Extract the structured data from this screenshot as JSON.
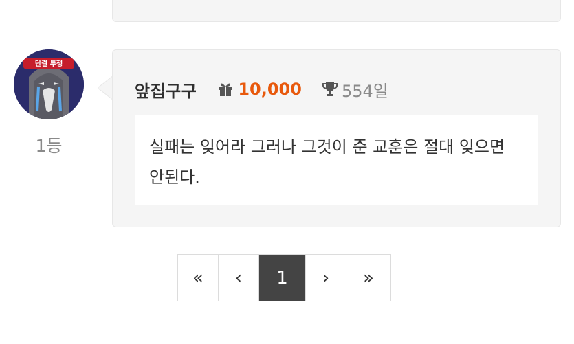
{
  "comment": {
    "rank": "1등",
    "nickname": "앞집구구",
    "points": "10,000",
    "days": "554일",
    "text": "실패는 잊어라 그러나 그것이 준 교훈은 절대 잊으면 안된다.",
    "avatar_caption": "단결 투쟁",
    "accent_color": "#e8590c"
  },
  "pagination": {
    "first": "«",
    "prev": "‹",
    "current": "1",
    "next": "›",
    "last": "»"
  }
}
